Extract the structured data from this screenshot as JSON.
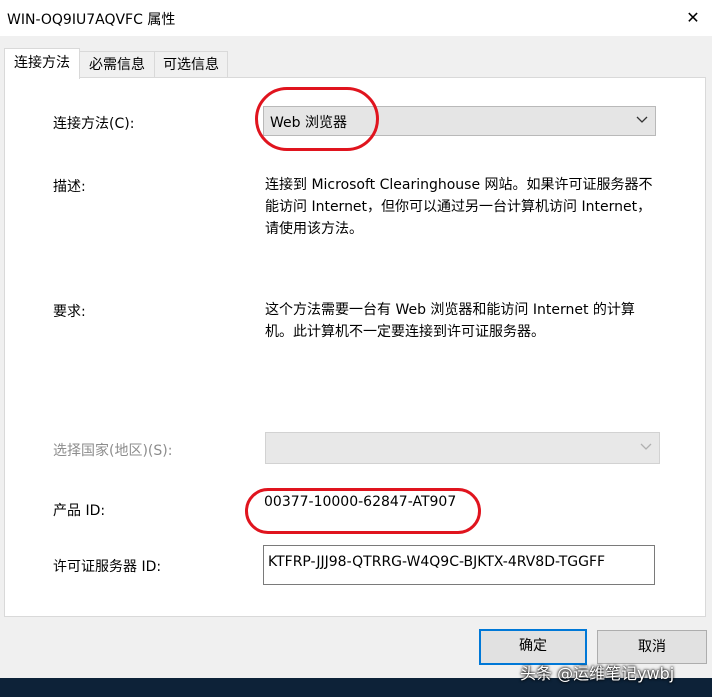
{
  "window": {
    "title": "WIN-OQ9IU7AQVFC 属性",
    "close_glyph": "✕"
  },
  "tabs": [
    {
      "label": "连接方法",
      "active": true
    },
    {
      "label": "必需信息",
      "active": false
    },
    {
      "label": "可选信息",
      "active": false
    }
  ],
  "form": {
    "connection_method_label": "连接方法(C):",
    "connection_method_value": "Web 浏览器",
    "description_label": "描述:",
    "description_lines": [
      "连接到 Microsoft Clearinghouse 网站。如果许可证服务器不",
      "能访问 Internet，但你可以通过另一台计算机访问 Internet，",
      "请使用该方法。"
    ],
    "requirements_label": "要求:",
    "requirements_lines": [
      "这个方法需要一台有 Web 浏览器和能访问 Internet 的计算",
      "机。此计算机不一定要连接到许可证服务器。"
    ],
    "country_label": "选择国家(地区)(S):",
    "country_value": "",
    "product_id_label": "产品 ID:",
    "product_id_value": "00377-10000-62847-AT907",
    "license_server_id_label": "许可证服务器 ID:",
    "license_server_id_value": "KTFRP-JJJ98-QTRRG-W4Q9C-BJKTX-4RV8D-TGGFF"
  },
  "buttons": {
    "ok": "确定",
    "cancel": "取消"
  },
  "watermark": "头条 @运维笔记ywbj",
  "colors": {
    "annotation_red": "#e0141e",
    "default_button_border": "#0078d7",
    "taskbar": "#0d2238"
  },
  "icons": {
    "dropdown": "chevron-down-icon",
    "close": "close-icon"
  }
}
